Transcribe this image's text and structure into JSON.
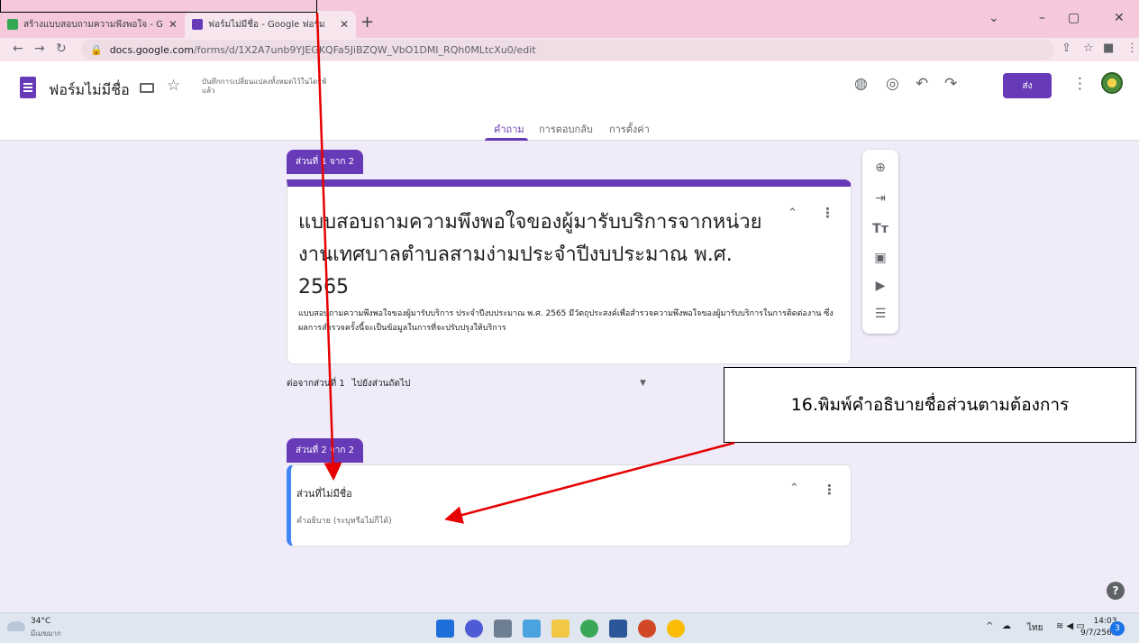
{
  "browser": {
    "tabs": [
      {
        "title": "สร้างแบบสอบถามความพึงพอใจ - Goo",
        "favicon_color": "#34a853",
        "active": false
      },
      {
        "title": "ฟอร์มไม่มีชื่อ - Google ฟอร์ม",
        "favicon_color": "#673ab7",
        "active": true
      }
    ],
    "new_tab": "+",
    "url_host": "docs.google.com",
    "url_path": "/forms/d/1X2A7unb9YJEGKQFa5JiBZQW_VbO1DMI_RQh0MLtcXu0/edit"
  },
  "form_header": {
    "doc_title": "ฟอร์มไม่มีชื่อ",
    "saved_note": "บันทึกการเปลี่ยนแปลงทั้งหมดไว้ในไดรฟ์แล้ว",
    "send_label": "ส่ง",
    "tabs": [
      "คำถาม",
      "การตอบกลับ",
      "การตั้งค่า"
    ]
  },
  "section1": {
    "label": "ส่วนที่ 1 จาก 2",
    "title": "แบบสอบถามความพึงพอใจของผู้มารับบริการจากหน่วยงานเทศบาลตำบลสามง่ามประจำปีงบประมาณ พ.ศ. 2565",
    "description": "แบบสอบถามความพึงพอใจของผู้มารับบริการ ประจำปีงบประมาณ พ.ศ. 2565 มีวัตถุประสงค์เพื่อสำรวจความพึงพอใจของผู้มารับบริการในการติดต่องาน ซึ่งผลการสำรวจครั้งนี้จะเป็นข้อมูลในการที่จะปรับปรุงให้บริการ",
    "after_label": "ต่อจากส่วนที่ 1",
    "after_choice": "ไปยังส่วนถัดไป"
  },
  "section2": {
    "label": "ส่วนที่ 2 จาก 2",
    "title": "ส่วนที่ไม่มีชื่อ",
    "description_placeholder": "คำอธิบาย (ระบุหรือไม่ก็ได้)"
  },
  "annotation": {
    "text": "16.พิมพ์คำอธิบายชื่อส่วนตามต้องการ",
    "arrow_color": "#e60000"
  },
  "taskbar": {
    "temperature": "34°C",
    "weather": "มีเมฆมาก",
    "language": "ไทย",
    "time": "14:03",
    "date": "9/7/2565",
    "notification_count": "3"
  },
  "colors": {
    "accent": "#673ab7",
    "background": "#f0ebf8",
    "tabstrip": "#f5c8dc"
  }
}
